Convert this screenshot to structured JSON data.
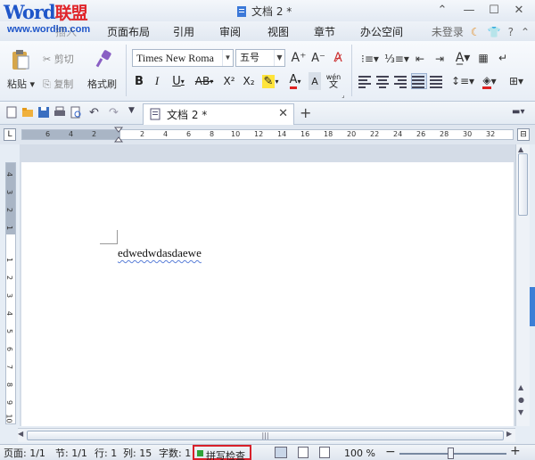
{
  "watermark": {
    "brand_latin": "Word",
    "brand_cn": "联盟",
    "url": "www.wordlm.com"
  },
  "window": {
    "title": "文档 2 *",
    "controls": {
      "minimize": "minimize-icon",
      "maximize": "maximize-icon",
      "close": "close-icon"
    }
  },
  "menu": {
    "tabs": [
      "开始",
      "插入",
      "页面布局",
      "引用",
      "审阅",
      "视图",
      "章节",
      "办公空间"
    ],
    "login": "未登录"
  },
  "ribbon": {
    "paste": "粘贴",
    "cut": "剪切",
    "copy": "复制",
    "format_painter": "格式刷",
    "font_name": "Times New Roma",
    "font_size": "五号",
    "grow_font": "A⁺",
    "shrink_font": "A⁻",
    "bold": "B",
    "italic": "I",
    "underline": "U",
    "strike": "AB",
    "superscript": "X²",
    "subscript": "X₂",
    "font_color": "A",
    "phonetic": "wén"
  },
  "tabbar": {
    "doc_tab": "文档 2 *"
  },
  "ruler": {
    "h_labels": [
      "6",
      "4",
      "2",
      "2",
      "4",
      "6",
      "8",
      "10",
      "12",
      "14",
      "16",
      "18",
      "20",
      "22",
      "24",
      "26",
      "28",
      "30",
      "32"
    ],
    "v_labels": [
      "4",
      "3",
      "2",
      "1",
      "1",
      "2",
      "3",
      "4",
      "5",
      "6",
      "7",
      "8",
      "9",
      "10"
    ]
  },
  "document": {
    "text": "edwedwdasdaewe"
  },
  "status": {
    "page": "页面: 1/1",
    "section": "节: 1/1",
    "line": "行: 1",
    "column": "列: 15",
    "words": "字数: 1",
    "spell_check": "拼写检查",
    "zoom": "100 %",
    "zoom_level_percent": 100
  },
  "colors": {
    "accent": "#3c7fd6",
    "highlight_box": "#d8202a",
    "spell_dot": "#2fa33a"
  }
}
